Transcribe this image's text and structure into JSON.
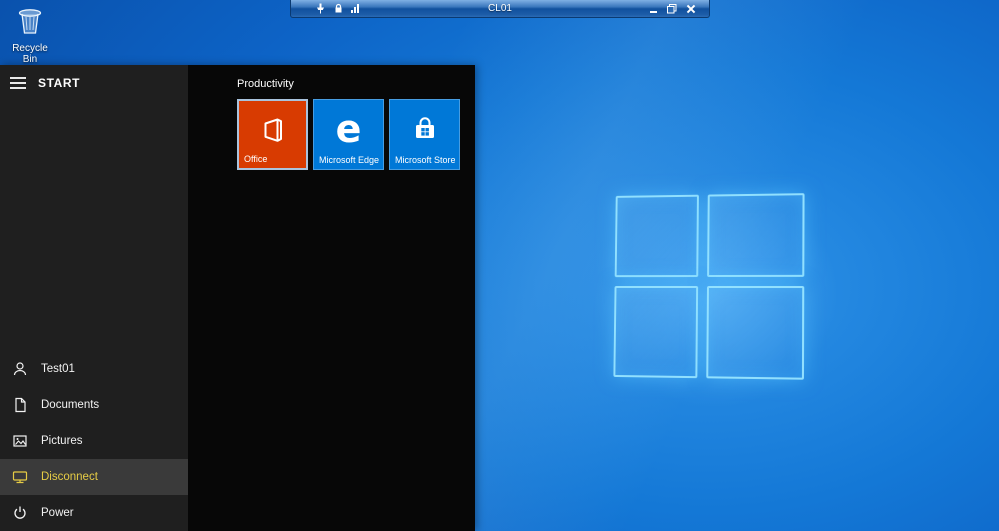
{
  "remote_session": {
    "title": "CL01",
    "status_icons": [
      "pin-icon",
      "lock-icon",
      "signal-icon"
    ],
    "window_buttons": [
      "minimize",
      "restore",
      "close"
    ]
  },
  "desktop": {
    "recycle_bin": {
      "label": "Recycle Bin"
    }
  },
  "start_menu": {
    "header": "START",
    "group_title": "Productivity",
    "tiles": [
      {
        "label": "Office",
        "color": "#d83b01",
        "selected": true
      },
      {
        "label": "Microsoft Edge",
        "color": "#0078d7",
        "glyph": "e"
      },
      {
        "label": "Microsoft Store",
        "color": "#0078d7"
      }
    ],
    "rail_items": [
      {
        "label": "Test01",
        "icon": "user-icon"
      },
      {
        "label": "Documents",
        "icon": "document-icon"
      },
      {
        "label": "Pictures",
        "icon": "pictures-icon"
      },
      {
        "label": "Disconnect",
        "icon": "disconnect-icon",
        "highlighted": true
      },
      {
        "label": "Power",
        "icon": "power-icon"
      }
    ]
  },
  "colors": {
    "wallpaper_center": "#2f93e8",
    "wallpaper_edge": "#0a52ad",
    "logo_glow": "#55c3ff",
    "start_rail_bg": "#1f1f1f",
    "start_panel_bg": "#070707",
    "highlight_row_bg": "#3a3a3a",
    "disconnect_text": "#e6cc45",
    "office_tile": "#d83b01",
    "edge_tile": "#0078d7",
    "store_tile": "#0078d7",
    "connection_bar": "#1c5ca8"
  }
}
